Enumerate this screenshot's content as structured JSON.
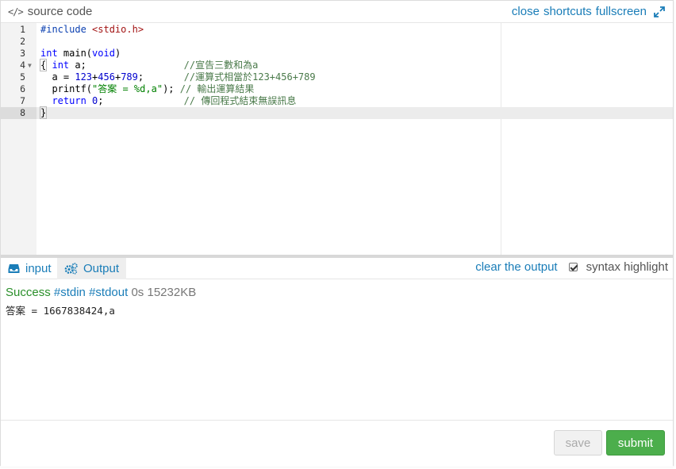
{
  "header": {
    "title": "source code",
    "actions": {
      "close": "close",
      "shortcuts": "shortcuts",
      "fullscreen": "fullscreen"
    }
  },
  "editor": {
    "lines": [
      {
        "num": "1",
        "text": "#include <stdio.h>"
      },
      {
        "num": "2",
        "text": ""
      },
      {
        "num": "3",
        "text": "int main(void)"
      },
      {
        "num": "4",
        "text": "{ int a;                 //宣告三數和為a"
      },
      {
        "num": "5",
        "text": "  a = 123+456+789;       //運算式相當於123+456+789"
      },
      {
        "num": "6",
        "text": "  printf(\"答案 = %d,a\"); // 輸出運算結果"
      },
      {
        "num": "7",
        "text": "  return 0;              // 傳回程式結束無誤訊息"
      },
      {
        "num": "8",
        "text": "}"
      }
    ]
  },
  "io": {
    "tabs": {
      "input": "input",
      "output": "Output"
    },
    "clear": "clear the output",
    "syntax_highlight": "syntax highlight",
    "syntax_highlight_checked": true
  },
  "output": {
    "status": "Success",
    "stdin": "#stdin",
    "stdout": "#stdout",
    "time": "0s",
    "memory": "15232KB",
    "text": "答案 = 1667838424,a"
  },
  "footer": {
    "save": "save",
    "submit": "submit"
  },
  "colors": {
    "link": "#1a7db8",
    "success": "#2a8f2a",
    "submit_bg": "#4cae4c"
  }
}
